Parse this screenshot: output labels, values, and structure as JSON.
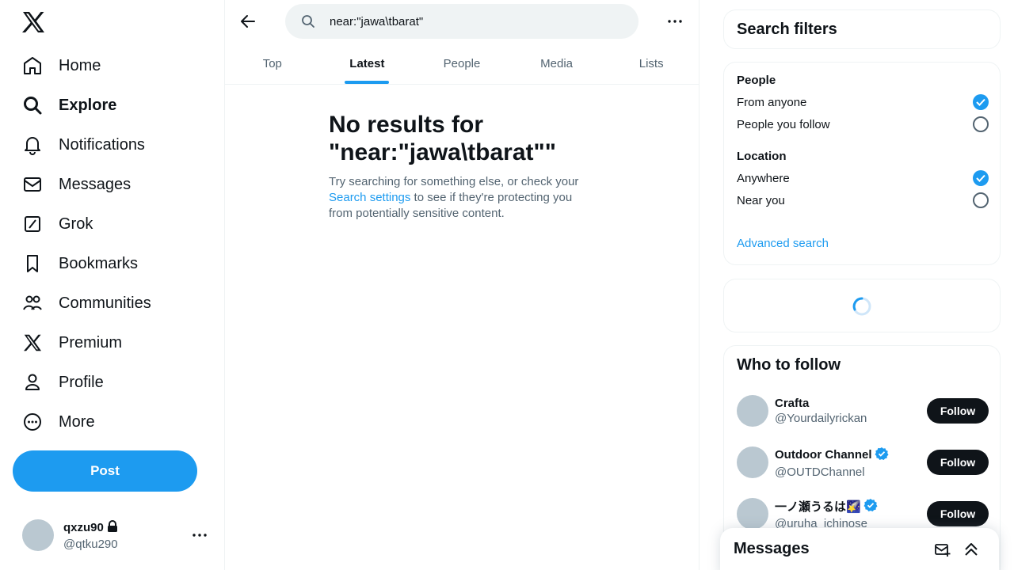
{
  "nav": {
    "items": [
      {
        "label": "Home",
        "icon": "home-icon"
      },
      {
        "label": "Explore",
        "icon": "search-icon"
      },
      {
        "label": "Notifications",
        "icon": "bell-icon"
      },
      {
        "label": "Messages",
        "icon": "envelope-icon"
      },
      {
        "label": "Grok",
        "icon": "grok-icon"
      },
      {
        "label": "Bookmarks",
        "icon": "bookmark-icon"
      },
      {
        "label": "Communities",
        "icon": "communities-icon"
      },
      {
        "label": "Premium",
        "icon": "x-logo-icon"
      },
      {
        "label": "Profile",
        "icon": "person-icon"
      },
      {
        "label": "More",
        "icon": "more-circle-icon"
      }
    ],
    "active": "Explore",
    "post_label": "Post"
  },
  "account": {
    "name": "qxzu90",
    "handle": "@qtku290"
  },
  "search": {
    "query": "near:\"jawa\\tbarat\""
  },
  "tabs": [
    "Top",
    "Latest",
    "People",
    "Media",
    "Lists"
  ],
  "active_tab": "Latest",
  "no_results": {
    "title": "No results for \"near:\"jawa\\tbarat\"\"",
    "text_before": "Try searching for something else, or check your ",
    "link": "Search settings",
    "text_after": " to see if they're protecting you from potentially sensitive content."
  },
  "filters": {
    "title": "Search filters",
    "people_label": "People",
    "people_options": [
      {
        "label": "From anyone",
        "checked": true
      },
      {
        "label": "People you follow",
        "checked": false
      }
    ],
    "location_label": "Location",
    "location_options": [
      {
        "label": "Anywhere",
        "checked": true
      },
      {
        "label": "Near you",
        "checked": false
      }
    ],
    "advanced_link": "Advanced search"
  },
  "who_to_follow": {
    "title": "Who to follow",
    "follow_label": "Follow",
    "accounts": [
      {
        "name": "Crafta",
        "handle": "@Yourdailyrickan",
        "verified": false
      },
      {
        "name": "Outdoor Channel",
        "handle": "@OUTDChannel",
        "verified": true
      },
      {
        "name": "一ノ瀬うるは🌠",
        "handle": "@uruha_ichinose",
        "verified": true
      }
    ]
  },
  "messages_drawer": {
    "title": "Messages"
  },
  "colors": {
    "accent": "#1d9bf0",
    "text": "#0f1419",
    "secondary": "#536471"
  }
}
